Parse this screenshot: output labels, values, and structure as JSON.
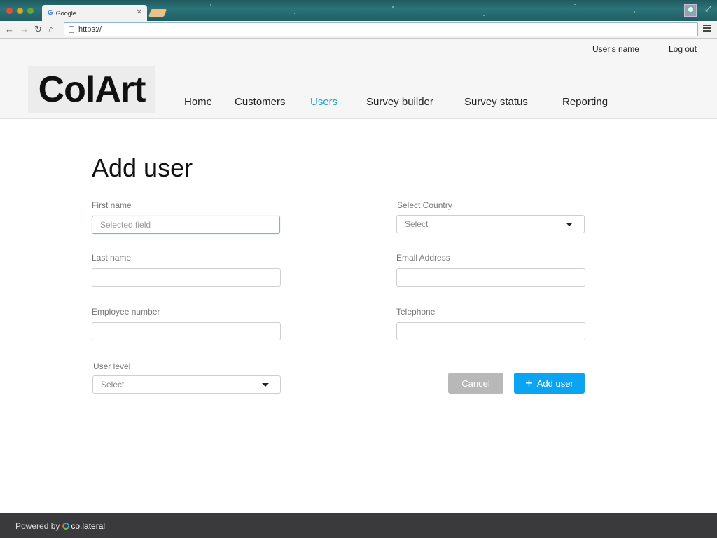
{
  "browser": {
    "tab_title": "Google",
    "tab_icon": "G",
    "url": "https://"
  },
  "header": {
    "user_name": "User's name",
    "logout": "Log out",
    "logo_text": "ColArt",
    "nav": [
      "Home",
      "Customers",
      "Users",
      "Survey builder",
      "Survey status",
      "Reporting"
    ],
    "active_nav": "Users",
    "active_color": "#1a9fe0"
  },
  "form": {
    "title": "Add user",
    "first_name_label": "First name",
    "first_name_placeholder": "Selected field",
    "last_name_label": "Last name",
    "employee_number_label": "Employee number",
    "user_level_label": "User level",
    "user_level_value": "Select",
    "country_label": "Select Country",
    "country_value": "Select",
    "email_label": "Email Address",
    "telephone_label": "Telephone",
    "cancel_label": "Cancel",
    "add_label": "Add user"
  },
  "footer": {
    "powered_by": "Powered by",
    "brand": "co.lateral"
  },
  "colors": {
    "primary_button": "#0aa4f2",
    "cancel_button": "#b8b8b8",
    "footer_bg": "#3a3a3c"
  }
}
